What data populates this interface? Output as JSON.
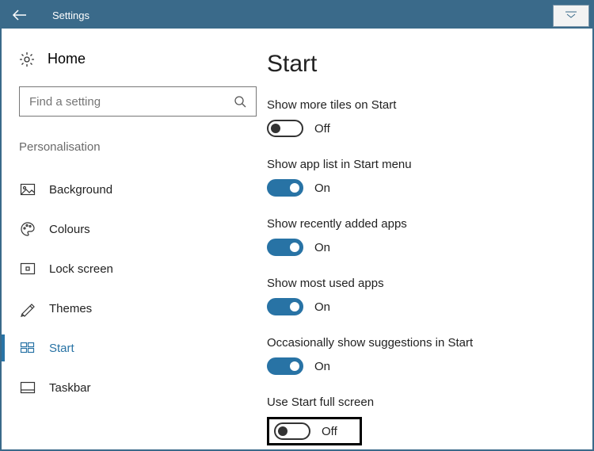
{
  "titlebar": {
    "title": "Settings"
  },
  "sidebar": {
    "home_label": "Home",
    "search_placeholder": "Find a setting",
    "category_label": "Personalisation",
    "items": [
      {
        "label": "Background"
      },
      {
        "label": "Colours"
      },
      {
        "label": "Lock screen"
      },
      {
        "label": "Themes"
      },
      {
        "label": "Start"
      },
      {
        "label": "Taskbar"
      }
    ]
  },
  "main": {
    "title": "Start",
    "settings": [
      {
        "label": "Show more tiles on Start",
        "state_label": "Off"
      },
      {
        "label": "Show app list in Start menu",
        "state_label": "On"
      },
      {
        "label": "Show recently added apps",
        "state_label": "On"
      },
      {
        "label": "Show most used apps",
        "state_label": "On"
      },
      {
        "label": "Occasionally show suggestions in Start",
        "state_label": "On"
      },
      {
        "label": "Use Start full screen",
        "state_label": "Off"
      }
    ]
  }
}
